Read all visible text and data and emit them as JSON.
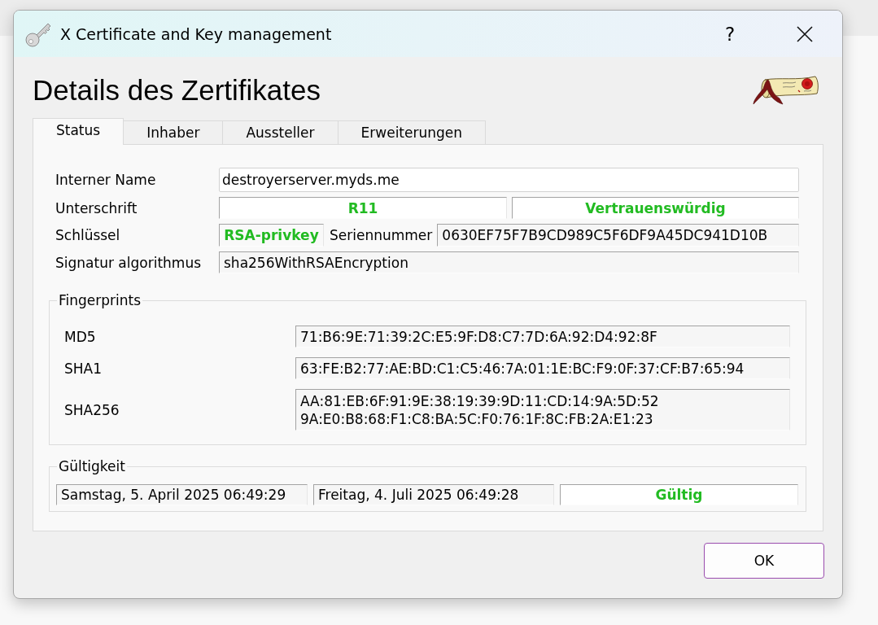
{
  "window": {
    "title": "X Certificate and Key management",
    "help_button": "?"
  },
  "heading": "Details des Zertifikates",
  "tabs": [
    {
      "label": "Status",
      "selected": true
    },
    {
      "label": "Inhaber",
      "selected": false
    },
    {
      "label": "Aussteller",
      "selected": false
    },
    {
      "label": "Erweiterungen",
      "selected": false
    }
  ],
  "status": {
    "internal_name": {
      "label": "Interner Name",
      "value": "destroyerserver.myds.me"
    },
    "signature": {
      "label": "Unterschrift",
      "issuer": {
        "value": "R11",
        "ok": true
      },
      "trust": {
        "value": "Vertrauenswürdig",
        "ok": true
      }
    },
    "key": {
      "label": "Schlüssel",
      "value": "RSA-privkey",
      "ok": true
    },
    "serial": {
      "label": "Seriennummer",
      "value": "0630EF75F7B9CD989C5F6DF9A45DC941D10B"
    },
    "algorithm": {
      "label": "Signatur algorithmus",
      "value": "sha256WithRSAEncryption"
    },
    "fingerprints": {
      "title": "Fingerprints",
      "rows": [
        {
          "label": "MD5",
          "lines": [
            "71:B6:9E:71:39:2C:E5:9F:D8:C7:7D:6A:92:D4:92:8F"
          ]
        },
        {
          "label": "SHA1",
          "lines": [
            "63:FE:B2:77:AE:BD:C1:C5:46:7A:01:1E:BC:F9:0F:37:CF:B7:65:94"
          ]
        },
        {
          "label": "SHA256",
          "lines": [
            "AA:81:EB:6F:91:9E:38:19:39:9D:11:CD:14:9A:5D:52",
            "9A:E0:B8:68:F1:C8:BA:5C:F0:76:1F:8C:FB:2A:E1:23"
          ]
        }
      ]
    },
    "validity": {
      "title": "Gültigkeit",
      "not_before": "Samstag, 5. April 2025 06:49:29",
      "not_after": "Freitag, 4. Juli 2025 06:49:28",
      "state": {
        "value": "Gültig",
        "ok": true
      }
    }
  },
  "buttons": [
    "OK"
  ]
}
